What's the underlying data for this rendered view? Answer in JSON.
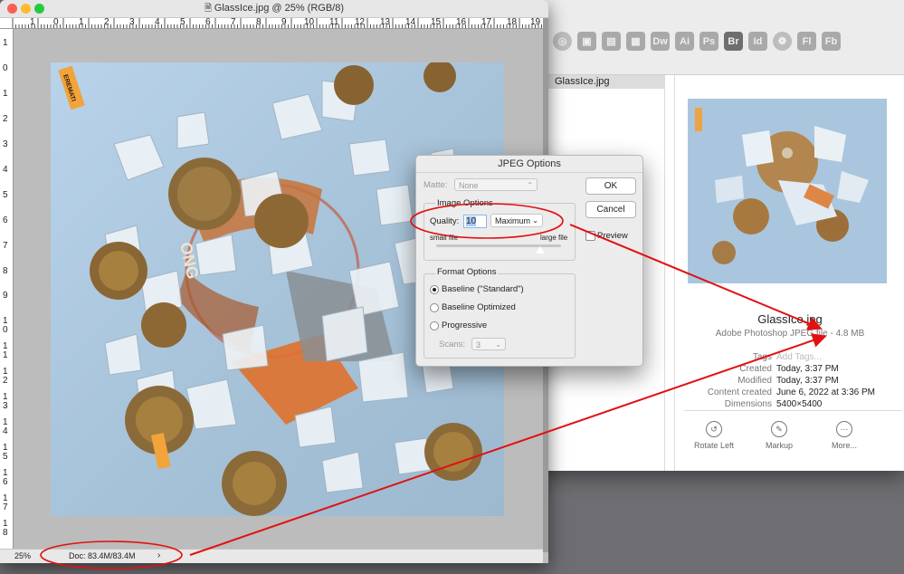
{
  "finder": {
    "app_icons": [
      "",
      "",
      "",
      "",
      "Dw",
      "Ai",
      "Ps",
      "Br",
      "Id",
      "",
      "Fl",
      "Fb"
    ],
    "file_row": "GlassIce.jpg",
    "preview": {
      "file_name": "GlassIce.jpg",
      "file_kind": "Adobe Photoshop JPEG file - 4.8 MB",
      "meta": [
        {
          "key": "Tags",
          "value": "Add Tags..."
        },
        {
          "key": "Created",
          "value": "Today, 3:37 PM"
        },
        {
          "key": "Modified",
          "value": "Today, 3:37 PM"
        },
        {
          "key": "Content created",
          "value": "June 6, 2022 at 3:36 PM"
        },
        {
          "key": "Dimensions",
          "value": "5400×5400"
        }
      ],
      "actions": [
        {
          "label": "Rotate Left",
          "icon": "rotate-left-icon"
        },
        {
          "label": "Markup",
          "icon": "markup-icon"
        },
        {
          "label": "More...",
          "icon": "more-icon"
        }
      ]
    }
  },
  "photoshop": {
    "title": "GlassIce.jpg @ 25% (RGB/8)",
    "ruler_h": [
      "1",
      "0",
      "1",
      "2",
      "3",
      "4",
      "5",
      "6",
      "7",
      "8",
      "9",
      "10",
      "11",
      "12",
      "13",
      "14",
      "15",
      "16",
      "17",
      "18",
      "19"
    ],
    "ruler_v": [
      "1",
      "0",
      "1",
      "2",
      "3",
      "4",
      "5",
      "6",
      "7",
      "8",
      "9",
      "1\n0",
      "1\n1",
      "1\n2",
      "1\n3",
      "1\n4",
      "1\n5",
      "1\n6",
      "1\n7",
      "1\n8"
    ],
    "zoom": "25%",
    "doc": "Doc: 83.4M/83.4M",
    "doc_arrow": "›",
    "photo_text": [
      "EREMATI",
      "ONG"
    ]
  },
  "jpeg_dialog": {
    "title": "JPEG Options",
    "matte_label": "Matte:",
    "matte_value": "None",
    "image_options": "Image Options",
    "quality_label": "Quality:",
    "quality_value": "10",
    "quality_preset": "Maximum",
    "small_file": "small file",
    "large_file": "large file",
    "slider_fraction": 0.83,
    "ok": "OK",
    "cancel": "Cancel",
    "preview": "Preview",
    "format_options": "Format Options",
    "formats": [
      "Baseline (\"Standard\")",
      "Baseline Optimized",
      "Progressive"
    ],
    "selected_format": 0,
    "scans_label": "Scans:",
    "scans_value": "3"
  },
  "colors": {
    "annotation": "#e11111",
    "photo_bg": "#a8c4dc"
  }
}
